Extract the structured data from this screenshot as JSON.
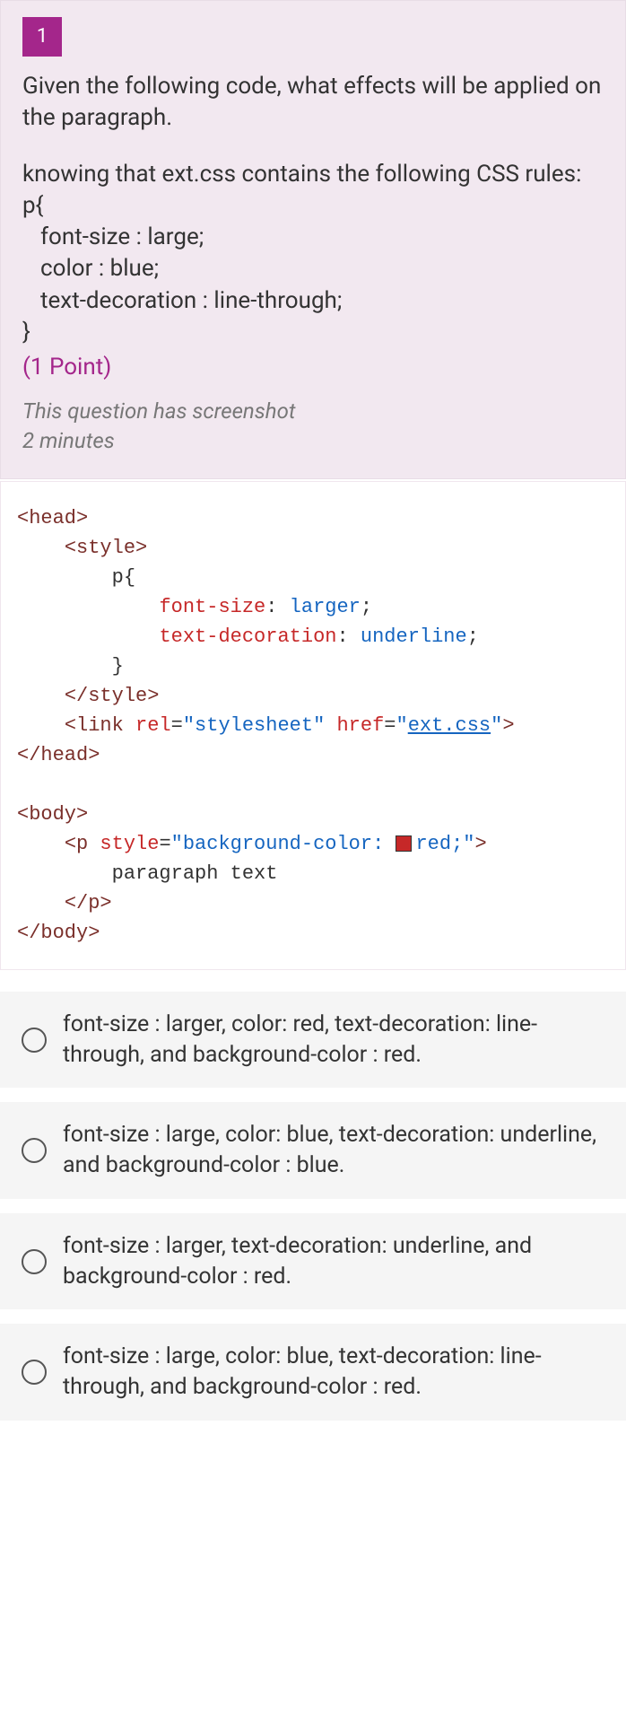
{
  "question": {
    "number": "1",
    "prompt": "Given the following code, what effects will be applied on the paragraph.",
    "sub_intro": "knowing that ext.css contains the following CSS rules:",
    "css_rule_open": "p{",
    "css_line1": "font-size : large;",
    "css_line2": "color : blue;",
    "css_line3": "text-decoration : line-through;",
    "css_rule_close": "}",
    "points": "(1 Point)",
    "meta1": "This question has screenshot",
    "meta2": "2 minutes"
  },
  "code": {
    "l1_open": "<head>",
    "l2_style_open": "<style>",
    "l3": "p{",
    "l4_prop": "font-size",
    "l4_val": "larger",
    "l5_prop": "text-decoration",
    "l5_val": "underline",
    "l6": "}",
    "l7_style_close": "</style>",
    "l8_tag": "link",
    "l8_a1": "rel",
    "l8_v1": "\"stylesheet\"",
    "l8_a2": "href",
    "l8_v2": "ext.css",
    "l9_head_close": "</head>",
    "l11_body_open": "<body>",
    "l12_tag": "p",
    "l12_a1": "style",
    "l12_v1_a": "\"background-color: ",
    "l12_v1_b": "red;\"",
    "l13": "paragraph text",
    "l14": "</p>",
    "l15": "</body>"
  },
  "options": [
    "font-size : larger, color: red, text-decoration: line-through, and background-color : red.",
    "font-size : large, color: blue, text-decoration: underline, and background-color : blue.",
    "font-size : larger, text-decoration: underline, and background-color : red.",
    "font-size : large, color: blue, text-decoration: line-through, and background-color : red."
  ]
}
